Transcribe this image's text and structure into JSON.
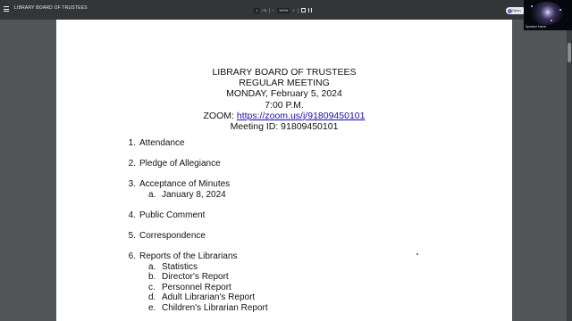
{
  "toolbar": {
    "title": "LIBRARY BOARD OF TRUSTEES",
    "page_current": "1",
    "page_total": "/ 5",
    "zoom": "100%",
    "open_button": "Open"
  },
  "document": {
    "header": {
      "line1": "LIBRARY BOARD OF TRUSTEES",
      "line2": "REGULAR MEETING",
      "line3": "MONDAY, February 5, 2024",
      "line4": "7:00 P.M.",
      "zoom_label": "ZOOM: ",
      "zoom_link": "https://zoom.us/j/91809450101",
      "meeting_id": "Meeting ID: 91809450101"
    },
    "agenda": [
      {
        "num": "1.",
        "label": "Attendance"
      },
      {
        "num": "2.",
        "label": "Pledge of Allegiance"
      },
      {
        "num": "3.",
        "label": "Acceptance of Minutes",
        "subitems": [
          {
            "letter": "a.",
            "label": "January 8, 2024"
          }
        ]
      },
      {
        "num": "4.",
        "label": "Public Comment"
      },
      {
        "num": "5.",
        "label": "Correspondence"
      },
      {
        "num": "6.",
        "label": "Reports of the Librarians",
        "subitems": [
          {
            "letter": "a.",
            "label": "Statistics"
          },
          {
            "letter": "b.",
            "label": "Director's Report"
          },
          {
            "letter": "c.",
            "label": "Personnel Report"
          },
          {
            "letter": "d.",
            "label": "Adult Librarian's Report"
          },
          {
            "letter": "e.",
            "label": "Children's Librarian Report"
          }
        ]
      }
    ]
  },
  "webcam": {
    "caption": "Speaker Name"
  }
}
